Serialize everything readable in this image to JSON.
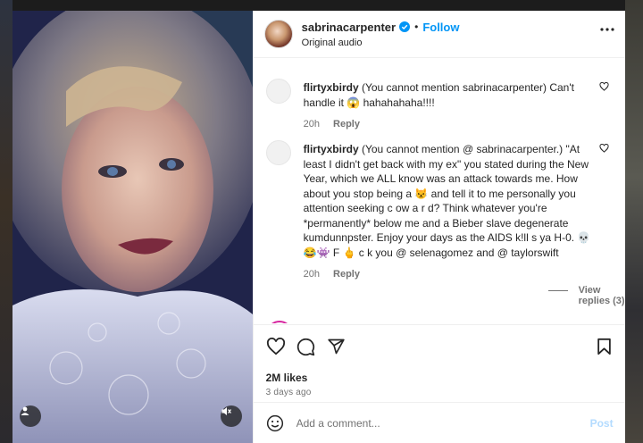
{
  "post": {
    "username": "sabrinacarpenter",
    "follow_label": "Follow",
    "audio": "Original audio",
    "likes": "2M likes",
    "date": "3 days ago"
  },
  "comments": [
    {
      "username": "flirtyxbirdy",
      "text": "(You cannot mention sabrinacarpenter) Can't handle it 😱 hahahahaha!!!!",
      "time": "20h",
      "reply_label": "Reply"
    },
    {
      "username": "flirtyxbirdy",
      "text": "(You cannot mention @ sabrinacarpenter.) \"At least I didn't get back with my ex\" you stated during the New Year, which we ALL know was an attack towards me. How about you stop being a 😾 and tell it to me personally you attention seeking c ow a r d? Think whatever you're *permanently* below me and a Bieber slave degenerate kumdunnpster. Enjoy your days as the AIDS k!ll s ya H-0. 💀😂👾 F 🖕 c k you @ selenagomez and @ taylorswift",
      "time": "20h",
      "reply_label": "Reply",
      "view_replies": "View replies (3)"
    }
  ],
  "add_comment": {
    "placeholder": "Add a comment...",
    "post_label": "Post"
  },
  "icons": {
    "verified": "verified-badge-icon",
    "more": "more-options-icon",
    "like": "heart-icon",
    "comment": "comment-bubble-icon",
    "share": "paper-plane-icon",
    "save": "bookmark-icon",
    "emoji": "smiley-icon",
    "muted": "speaker-muted-icon",
    "tagged": "user-tag-icon"
  },
  "colors": {
    "accent": "#0095f6",
    "post_disabled": "#b3dbff",
    "muted_text": "#737373"
  }
}
